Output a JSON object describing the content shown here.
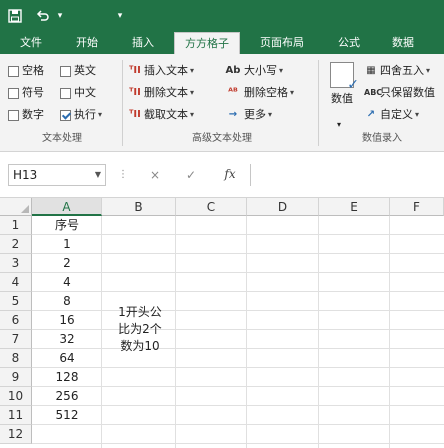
{
  "quick_access": {
    "save_icon": "save-icon",
    "undo_icon": "undo-icon",
    "undo_arrow": "▾",
    "customize_arrow": "▾"
  },
  "tabs": [
    {
      "label": "文件"
    },
    {
      "label": "开始"
    },
    {
      "label": "插入"
    },
    {
      "label": "方方格子",
      "active": true
    },
    {
      "label": "页面布局"
    },
    {
      "label": "公式"
    },
    {
      "label": "数据"
    }
  ],
  "ribbon": {
    "text_group": {
      "label": "文本处理",
      "row1": [
        {
          "label": "空格",
          "checked": false
        },
        {
          "label": "英文",
          "checked": false
        }
      ],
      "row2": [
        {
          "label": "符号",
          "checked": false
        },
        {
          "label": "中文",
          "checked": false
        }
      ],
      "row3": [
        {
          "label": "数字",
          "checked": false
        },
        {
          "label": "执行",
          "checked": true
        }
      ]
    },
    "advanced_group": {
      "label": "高级文本处理",
      "insert_text": "插入文本",
      "delete_text": "删除文本",
      "extract_text": "截取文本",
      "case_label": "大小写",
      "delete_space": "删除空格",
      "more": "更多"
    },
    "number_group": {
      "label": "数值录入",
      "value_button": "数值",
      "round": "四舍五入",
      "keep_value": "只保留数值",
      "custom": "自定义"
    }
  },
  "formula_bar": {
    "name_box": "H13",
    "cancel": "×",
    "confirm": "✓",
    "fx": "fx",
    "formula": ""
  },
  "columns": [
    "A",
    "B",
    "C",
    "D",
    "E",
    "F"
  ],
  "selected_column": "A",
  "rows": [
    1,
    2,
    3,
    4,
    5,
    6,
    7,
    8,
    9,
    10,
    11,
    12
  ],
  "column_a": [
    "序号",
    "1",
    "2",
    "4",
    "8",
    "16",
    "32",
    "64",
    "128",
    "256",
    "512",
    ""
  ],
  "note": {
    "line1": "1开头公",
    "line2": "比为2个",
    "line3": "数为10"
  }
}
